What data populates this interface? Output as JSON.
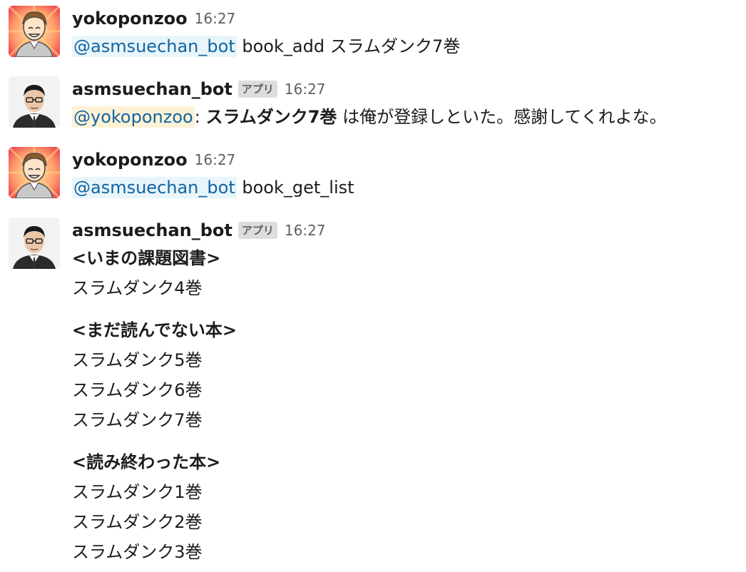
{
  "messages": [
    {
      "author": "yokoponzoo",
      "time": "16:27",
      "avatar": "cartoon-avatar-icon",
      "mention": "@asmsuechan_bot",
      "text": "book_add スラムダンク7巻"
    },
    {
      "author": "asmsuechan_bot",
      "badge": "アプリ",
      "time": "16:27",
      "avatar": "photo-avatar-icon",
      "mention": "@yokoponzoo",
      "separator": ":",
      "bold_text": "スラムダンク7巻",
      "text": "は俺が登録しといた。感謝してくれよな。"
    },
    {
      "author": "yokoponzoo",
      "time": "16:27",
      "avatar": "cartoon-avatar-icon",
      "mention": "@asmsuechan_bot",
      "text": "book_get_list"
    },
    {
      "author": "asmsuechan_bot",
      "badge": "アプリ",
      "time": "16:27",
      "avatar": "photo-avatar-icon",
      "sections": [
        {
          "heading": "<いまの課題図書>",
          "items": [
            "スラムダンク4巻"
          ]
        },
        {
          "heading": "<まだ読んでない本>",
          "items": [
            "スラムダンク5巻",
            "スラムダンク6巻",
            "スラムダンク7巻"
          ]
        },
        {
          "heading": "<読み終わった本>",
          "items": [
            "スラムダンク1巻",
            "スラムダンク2巻",
            "スラムダンク3巻"
          ]
        }
      ]
    }
  ],
  "colors": {
    "mention_text": "#1264a3",
    "mention_bg": "#e8f5fa",
    "self_mention_bg": "#fdf2d5",
    "badge_bg": "#dddddd",
    "muted": "#616061"
  }
}
